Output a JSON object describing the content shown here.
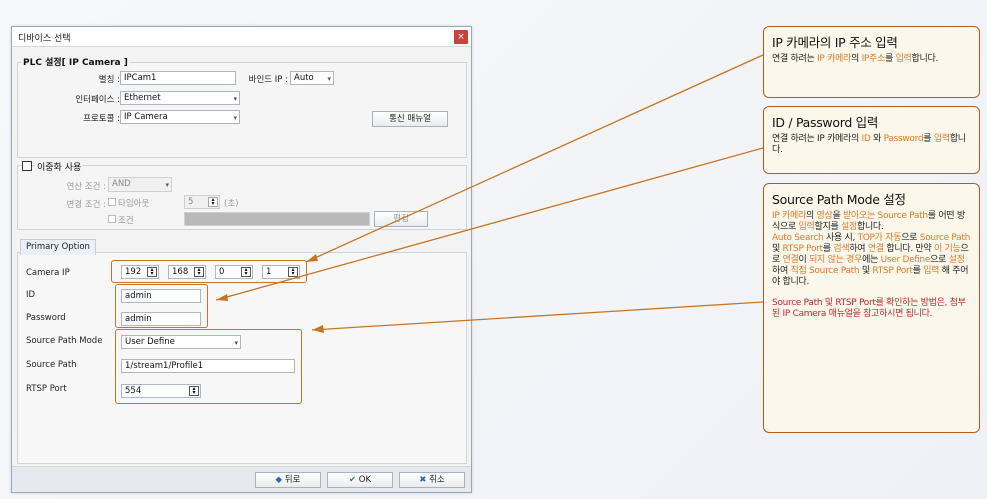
{
  "dialog": {
    "title": "디바이스 선택",
    "close_glyph": "×",
    "plc_group_title": "PLC 설정[ IP Camera ]",
    "nickname_label": "별칭 :",
    "nickname_value": "IPCam1",
    "bind_ip_label": "바인드 IP :",
    "bind_ip_value": "Auto",
    "interface_label": "인터페이스 :",
    "interface_value": "Ethernet",
    "protocol_label": "프로토콜 :",
    "protocol_value": "IP Camera",
    "comm_manual_button": "통신 매뉴얼",
    "redundancy_label": "이중화 사용",
    "operation_cond_label": "연산 조건 :",
    "operation_cond_value": "AND",
    "change_cond_label": "변경 조건 :",
    "timeout_label": "타임아웃",
    "timeout_value": "5",
    "timeout_unit": "(초)",
    "condition_label": "조건",
    "edit_button": "편집",
    "tab_primary": "Primary Option",
    "camera_ip_label": "Camera IP",
    "ip_octets": [
      "192",
      "168",
      "0",
      "1"
    ],
    "id_label": "ID",
    "id_value": "admin",
    "password_label": "Password",
    "password_value": "admin",
    "source_path_mode_label": "Source Path Mode",
    "source_path_mode_value": "User Define",
    "source_path_label": "Source Path",
    "source_path_value": "1/stream1/Profile1",
    "rtsp_port_label": "RTSP Port",
    "rtsp_port_value": "554",
    "back_button": "뒤로",
    "ok_button": "OK",
    "cancel_button": "취소"
  },
  "callouts": {
    "ip": {
      "title": "IP 카메라의 IP 주소 입력",
      "t1": "연결 하려는 ",
      "t2": "IP 카메라",
      "t3": "의 ",
      "t4": "IP주소",
      "t5": "를 ",
      "t6": "입력",
      "t7": "합니다."
    },
    "idpw": {
      "title": "ID / Password 입력",
      "t1": "연결 하려는 IP 카메라의 ",
      "t2": "ID",
      "t3": " 와 ",
      "t4": "Password",
      "t5": "를 ",
      "t6": "입력",
      "t7": "합니다."
    },
    "source": {
      "title": "Source Path Mode 설정",
      "p1": [
        {
          "t": "IP 카메라",
          "c": "o"
        },
        {
          "t": "의 ",
          "c": ""
        },
        {
          "t": "영상",
          "c": "o"
        },
        {
          "t": "을 ",
          "c": ""
        },
        {
          "t": "받아오는 Source Path",
          "c": "o"
        },
        {
          "t": "를 어떤 방식으로 ",
          "c": ""
        },
        {
          "t": "입력",
          "c": "o"
        },
        {
          "t": "할지를 ",
          "c": ""
        },
        {
          "t": "설정",
          "c": "o"
        },
        {
          "t": "합니다.",
          "c": ""
        }
      ],
      "p2": [
        {
          "t": "Auto Search",
          "c": "o"
        },
        {
          "t": " 사용 시, ",
          "c": ""
        },
        {
          "t": "TOP가 자동",
          "c": "o"
        },
        {
          "t": "으로 ",
          "c": ""
        },
        {
          "t": "Source Path",
          "c": "o"
        },
        {
          "t": " 및 ",
          "c": ""
        },
        {
          "t": "RTSP Port",
          "c": "o"
        },
        {
          "t": "를 ",
          "c": ""
        },
        {
          "t": "검색",
          "c": "o"
        },
        {
          "t": "하여 ",
          "c": ""
        },
        {
          "t": "연결",
          "c": "o"
        },
        {
          "t": " 합니다. 만약 ",
          "c": ""
        },
        {
          "t": "이 기능",
          "c": "o"
        },
        {
          "t": "으로 ",
          "c": ""
        },
        {
          "t": "연결",
          "c": "o"
        },
        {
          "t": "이 ",
          "c": ""
        },
        {
          "t": "되지 않는 경우",
          "c": "o"
        },
        {
          "t": "에는 ",
          "c": ""
        },
        {
          "t": "User Define",
          "c": "o"
        },
        {
          "t": "으로 ",
          "c": ""
        },
        {
          "t": "설정",
          "c": "o"
        },
        {
          "t": "하여 ",
          "c": ""
        },
        {
          "t": "직접 Source Path",
          "c": "o"
        },
        {
          "t": " 및 ",
          "c": ""
        },
        {
          "t": "RTSP Port",
          "c": "o"
        },
        {
          "t": "를 ",
          "c": ""
        },
        {
          "t": "입력",
          "c": "o"
        },
        {
          "t": " 해 주어야 합니다.",
          "c": ""
        }
      ],
      "p3": "Source Path 및 RTSP Port를 확인하는 방법은, 첨부된 IP Camera 매뉴얼을 참고하시면 됩니다."
    }
  },
  "icons": {
    "back": "◆",
    "ok": "✔",
    "cancel": "✖",
    "dropdown": "▾",
    "spin_up": "▴",
    "spin_down": "▾"
  },
  "colors": {
    "callout_border": "#b85a1d",
    "highlight": "#e47a2a",
    "emphasis": "#c0282d"
  }
}
